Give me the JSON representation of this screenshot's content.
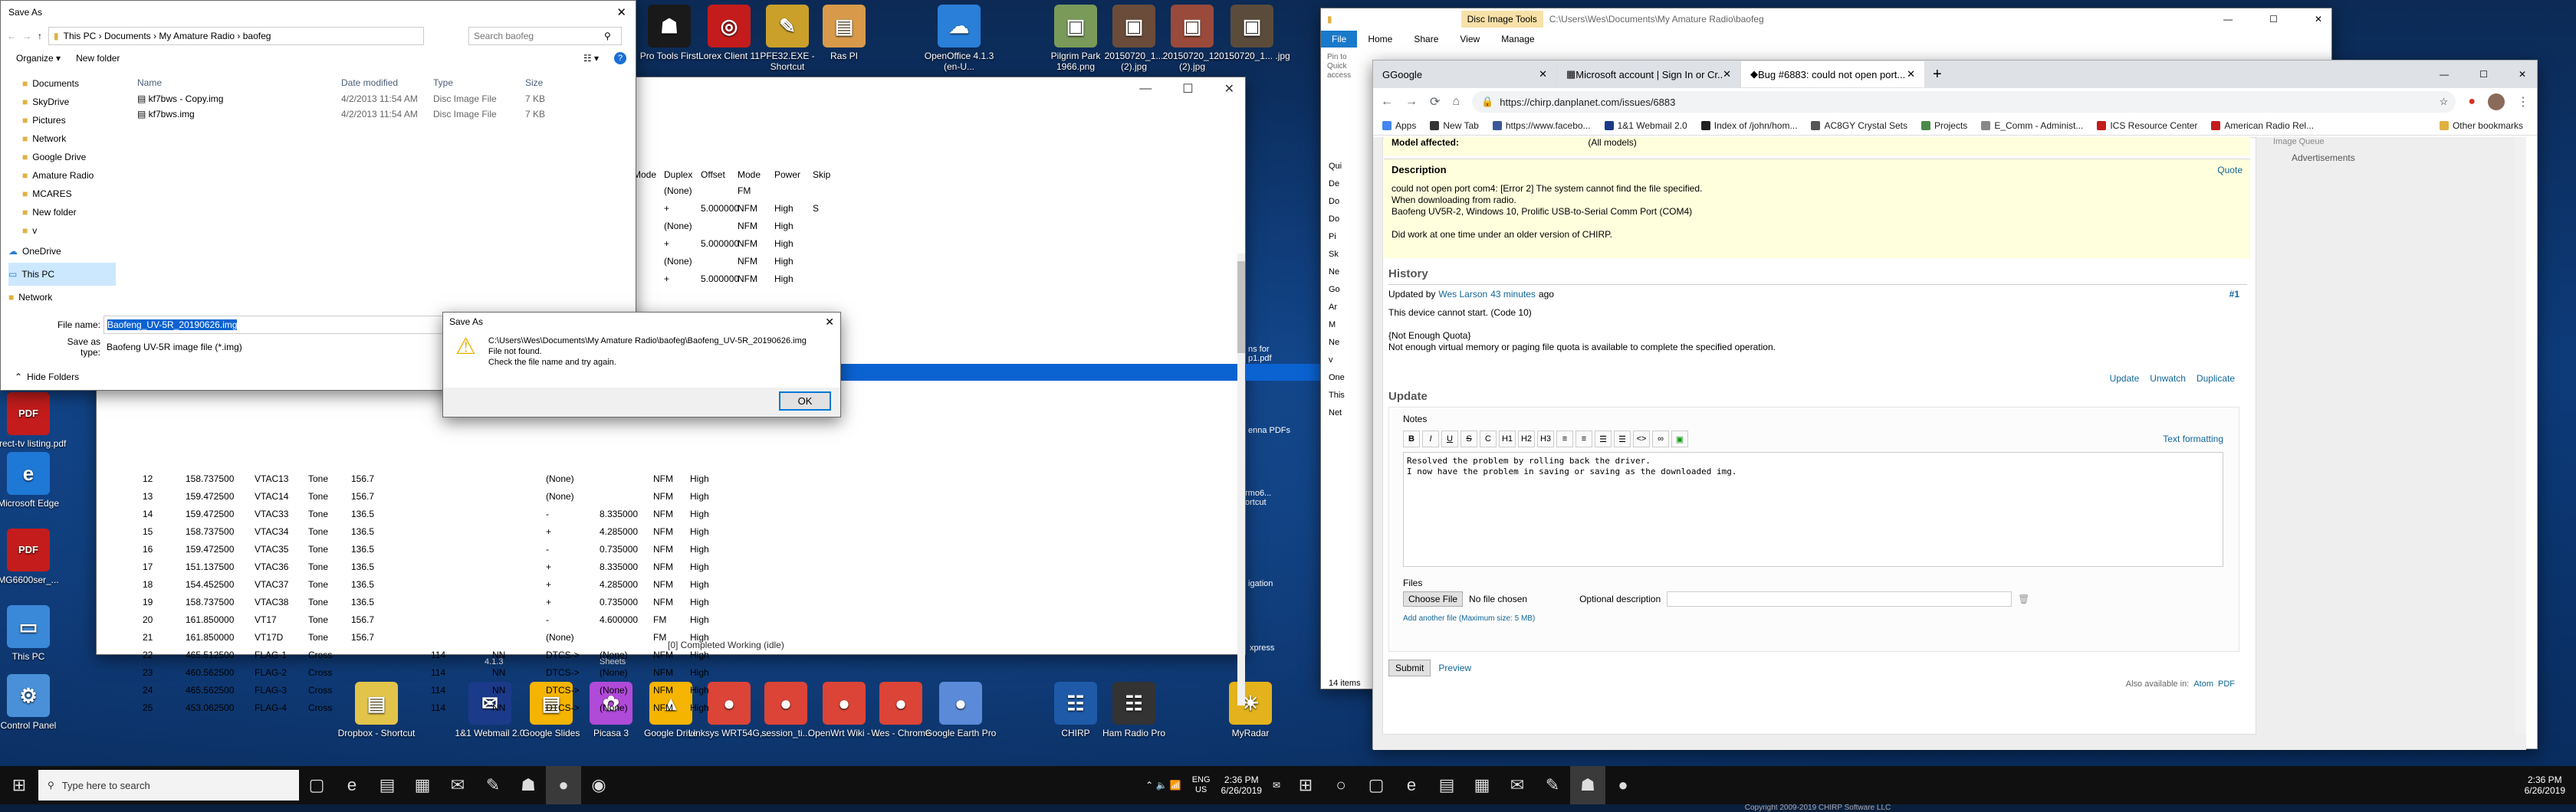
{
  "desktop": {
    "icons_top": [
      {
        "label": "Pro Tools First",
        "color": "#1a1a1a",
        "glyph": "☗"
      },
      {
        "label": "Lorex Client 11",
        "color": "#c41c1c",
        "glyph": "◎"
      },
      {
        "label": "PFE32.EXE - Shortcut",
        "color": "#caa02a",
        "glyph": "✎"
      },
      {
        "label": "Ras PI",
        "color": "#d89a4a",
        "glyph": "▤"
      },
      {
        "label": "OpenOffice 4.1.3 (en-U...",
        "color": "#2a7fd8",
        "glyph": "☁"
      },
      {
        "label": "Pilgrim Park 1966.png",
        "color": "#7a9a5a",
        "glyph": "▣"
      },
      {
        "label": "20150720_1... (2).jpg",
        "color": "#6b4c3b",
        "glyph": "▣"
      },
      {
        "label": "20150720_1... (2).jpg",
        "color": "#9a4a3a",
        "glyph": "▣"
      },
      {
        "label": "20150720_1... .jpg",
        "color": "#5b4b3b",
        "glyph": "▣"
      }
    ],
    "icons_left": [
      {
        "label": "Direct-tv listing.pdf",
        "color": "#c41c1c",
        "glyph": "PDF"
      },
      {
        "label": "Microsoft Edge",
        "color": "#1e78d6",
        "glyph": "e"
      },
      {
        "label": "MG6600ser_...",
        "color": "#c41c1c",
        "glyph": "PDF"
      },
      {
        "label": "This PC",
        "color": "#3a88d8",
        "glyph": "▭"
      },
      {
        "label": "Control Panel",
        "color": "#4a90d9",
        "glyph": "⚙"
      }
    ],
    "icons_bottom": [
      {
        "label": "Dropbox - Shortcut",
        "color": "#e2c44a",
        "glyph": "▤"
      },
      {
        "label": "1&1 Webmail 2.0",
        "color": "#1c3a8a",
        "glyph": "✉"
      },
      {
        "label": "Google Slides",
        "color": "#f4b400",
        "glyph": "▤"
      },
      {
        "label": "Picasa 3",
        "color": "#b04ad8",
        "glyph": "✿"
      },
      {
        "label": "Google Drive",
        "color": "#f4b400",
        "glyph": "▲"
      },
      {
        "label": "Linksys WRT54G,...",
        "color": "#db4437",
        "glyph": "●"
      },
      {
        "label": "session_ti...",
        "color": "#db4437",
        "glyph": "●"
      },
      {
        "label": "OpenWrt Wiki - ...",
        "color": "#db4437",
        "glyph": "●"
      },
      {
        "label": "Wes - Chrome",
        "color": "#db4437",
        "glyph": "●"
      },
      {
        "label": "Google Earth Pro",
        "color": "#5a8ad8",
        "glyph": "●"
      },
      {
        "label": "CHIRP",
        "color": "#1e5aa8",
        "glyph": "☷"
      },
      {
        "label": "Ham Radio Pro",
        "color": "#333",
        "glyph": "☷"
      },
      {
        "label": "MyRadar",
        "color": "#e3b21c",
        "glyph": "☀"
      }
    ],
    "stray_labels": [
      "4.1.3",
      "Sheets",
      "ns for p1.pdf",
      "enna PDFs",
      "rmo6... ortcut",
      "igation",
      "xpress"
    ]
  },
  "chirp": {
    "columns": [
      "Mode",
      "Duplex",
      "Offset",
      "Mode",
      "Power",
      "Skip"
    ],
    "top_rows": [
      [
        "",
        "(None)",
        "",
        "FM",
        "",
        ""
      ],
      [
        "",
        "+",
        "5.000000",
        "NFM",
        "High",
        "S"
      ],
      [
        "",
        "(None)",
        "",
        "NFM",
        "High",
        ""
      ],
      [
        "",
        "+",
        "5.000000",
        "NFM",
        "High",
        ""
      ],
      [
        "",
        "(None)",
        "",
        "NFM",
        "High",
        ""
      ],
      [
        "",
        "+",
        "5.000000",
        "NFM",
        "High",
        ""
      ],
      [
        "",
        "(None)",
        "",
        "NFM",
        "High",
        ""
      ]
    ],
    "rows": [
      [
        "12",
        "158.737500",
        "VTAC13",
        "Tone",
        "156.7",
        "",
        "",
        "(None)",
        "",
        "NFM",
        "High"
      ],
      [
        "13",
        "159.472500",
        "VTAC14",
        "Tone",
        "156.7",
        "",
        "",
        "(None)",
        "",
        "NFM",
        "High"
      ],
      [
        "14",
        "159.472500",
        "VTAC33",
        "Tone",
        "136.5",
        "",
        "",
        "-",
        "8.335000",
        "NFM",
        "High"
      ],
      [
        "15",
        "158.737500",
        "VTAC34",
        "Tone",
        "136.5",
        "",
        "",
        "+",
        "4.285000",
        "NFM",
        "High"
      ],
      [
        "16",
        "159.472500",
        "VTAC35",
        "Tone",
        "136.5",
        "",
        "",
        "-",
        "0.735000",
        "NFM",
        "High"
      ],
      [
        "17",
        "151.137500",
        "VTAC36",
        "Tone",
        "136.5",
        "",
        "",
        "+",
        "8.335000",
        "NFM",
        "High"
      ],
      [
        "18",
        "154.452500",
        "VTAC37",
        "Tone",
        "136.5",
        "",
        "",
        "+",
        "4.285000",
        "NFM",
        "High"
      ],
      [
        "19",
        "158.737500",
        "VTAC38",
        "Tone",
        "136.5",
        "",
        "",
        "+",
        "0.735000",
        "NFM",
        "High"
      ],
      [
        "20",
        "161.850000",
        "VT17",
        "Tone",
        "156.7",
        "",
        "",
        "-",
        "4.600000",
        "FM",
        "High"
      ],
      [
        "21",
        "161.850000",
        "VT17D",
        "Tone",
        "156.7",
        "",
        "",
        "(None)",
        "",
        "FM",
        "High"
      ],
      [
        "22",
        "465.512500",
        "FLAG-1",
        "Cross",
        "",
        "114",
        "NN",
        "DTCS->",
        "(None)",
        "",
        "NFM",
        "High"
      ],
      [
        "23",
        "460.562500",
        "FLAG-2",
        "Cross",
        "",
        "114",
        "NN",
        "DTCS->",
        "(None)",
        "",
        "NFM",
        "High"
      ],
      [
        "24",
        "465.562500",
        "FLAG-3",
        "Cross",
        "",
        "114",
        "NN",
        "DTCS->",
        "(None)",
        "",
        "NFM",
        "High"
      ],
      [
        "25",
        "453.062500",
        "FLAG-4",
        "Cross",
        "",
        "114",
        "NN",
        "DTCS->",
        "(None)",
        "",
        "NFM",
        "High"
      ]
    ],
    "status": "[0] Completed Working (idle)"
  },
  "saveas": {
    "title": "Save As",
    "breadcrumb": [
      "This PC",
      "Documents",
      "My Amature Radio",
      "baofeg"
    ],
    "search_placeholder": "Search baofeg",
    "organize": "Organize ▾",
    "new_folder": "New folder",
    "tree": [
      "Documents",
      "SkyDrive",
      "Pictures",
      "Network",
      "Google Drive",
      "Amature Radio",
      "MCARES",
      "New folder",
      "v",
      "OneDrive",
      "This PC",
      "Network"
    ],
    "col_name": "Name",
    "col_date": "Date modified",
    "col_type": "Type",
    "col_size": "Size",
    "files": [
      {
        "name": "kf7bws - Copy.img",
        "date": "4/2/2013 11:54 AM",
        "type": "Disc Image File",
        "size": "7 KB"
      },
      {
        "name": "kf7bws.img",
        "date": "4/2/2013 11:54 AM",
        "type": "Disc Image File",
        "size": "7 KB"
      }
    ],
    "file_name_label": "File name:",
    "file_name_value": "Baofeng_UV-5R_20190626.img",
    "save_type_label": "Save as type:",
    "save_type_value": "Baofeng UV-5R image file (*.img)",
    "hide_folders": "Hide Folders"
  },
  "error": {
    "title": "Save As",
    "path": "C:\\Users\\Wes\\Documents\\My Amature Radio\\baofeg\\Baofeng_UV-5R_20190626.img",
    "line2": "File not found.",
    "line3": "Check the file name and try again.",
    "ok": "OK"
  },
  "explorer": {
    "tool_tab": "Disc Image Tools",
    "path": "C:\\Users\\Wes\\Documents\\My Amature Radio\\baofeg",
    "ribbon": [
      "File",
      "Home",
      "Share",
      "View",
      "Manage"
    ],
    "pin": "Pin to Quick access",
    "nav_items": [
      "Qui",
      "De",
      "Do",
      "Do",
      "Pi",
      "Sk",
      "Ne",
      "Go",
      "Ar",
      "M",
      "Ne",
      "v",
      "One",
      "This",
      "Net"
    ],
    "items_count": "14 items"
  },
  "browser": {
    "tabs": [
      "Google",
      "Microsoft account | Sign In or Cr...",
      "Bug #6883: could not open port..."
    ],
    "url": "https://chirp.danplanet.com/issues/6883",
    "bookmarks": [
      "Apps",
      "New Tab",
      "https://www.facebo...",
      "1&1 Webmail 2.0",
      "Index of /john/hom...",
      "AC8GY Crystal Sets",
      "Projects",
      "E_Comm - Administ...",
      "ICS Resource Center",
      "American Radio Rel...",
      "Other bookmarks"
    ],
    "model_label": "Model affected:",
    "model_value": "(All models)",
    "desc_heading": "Description",
    "quote": "Quote",
    "desc_lines": [
      "could not open port com4: [Error 2] The system cannot find the file specified.",
      "When downloading from radio.",
      "Baofeng UV5R-2, Windows 10, Prolific USB-to-Serial Comm Port (COM4)",
      "",
      "Did work at one time under an older version of CHIRP."
    ],
    "history": "History",
    "updated_by": "Updated by",
    "updated_user": "Wes Larson",
    "updated_ago": "43 minutes",
    "updated_suffix": "ago",
    "note_num": "#1",
    "history_lines": [
      "This device cannot start. (Code 10)",
      "",
      "{Not Enough Quota}",
      "Not enough virtual memory or paging file quota is available to complete the specified operation."
    ],
    "actions": [
      "Update",
      "Unwatch",
      "Duplicate"
    ],
    "update": "Update",
    "notes": "Notes",
    "text_formatting": "Text formatting",
    "notes_text": "Resolved the problem by rolling back the driver.\nI now have the problem in saving or saving as the downloaded img.",
    "files": "Files",
    "choose_file": "Choose File",
    "no_file": "No file chosen",
    "optional_desc": "Optional description",
    "add_another": "Add another file (Maximum size: 5 MB)",
    "submit": "Submit",
    "preview": "Preview",
    "also_available": "Also available in:",
    "atom": "Atom",
    "pdf": "PDF",
    "copyright": "Copyright 2009-2019 CHIRP Software LLC",
    "sidebar_ad": "Advertisements",
    "sidebar_top": "Image Queue"
  },
  "taskbar": {
    "search": "Type here to search",
    "lang": "ENG",
    "region": "US",
    "time": "2:36 PM",
    "date": "6/26/2019"
  }
}
